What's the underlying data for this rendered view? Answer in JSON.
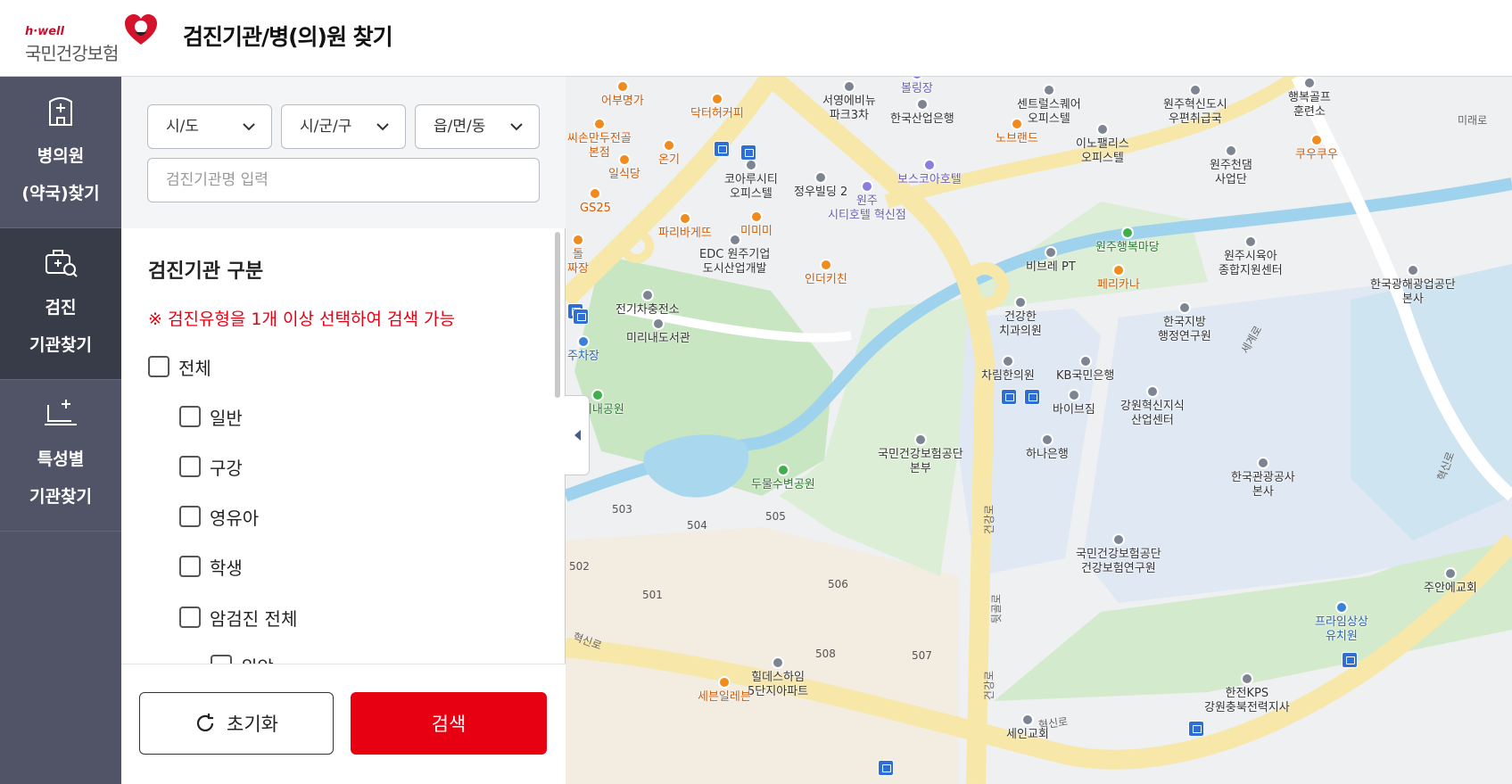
{
  "header": {
    "logo_hwell": "h·well",
    "logo_name": "국민건강보험",
    "title": "검진기관/병(의)원 찾기"
  },
  "sidenav": {
    "items": [
      {
        "label": "병의원\n(약국)찾기",
        "icon": "hospital-building-icon",
        "active": false
      },
      {
        "label": "검진\n기관찾기",
        "icon": "medical-bag-search-icon",
        "active": true
      },
      {
        "label": "특성별\n기관찾기",
        "icon": "laptop-medical-icon",
        "active": false
      }
    ]
  },
  "filters": {
    "sido": "시/도",
    "sigungu": "시/군/구",
    "eupmyeondong": "읍/면/동",
    "search_placeholder": "검진기관명 입력"
  },
  "section": {
    "title": "검진기관 구분",
    "notice": "※ 검진유형을 1개 이상 선택하여 검색 가능"
  },
  "checkboxes": [
    {
      "label": "전체",
      "level": 0,
      "checked": false
    },
    {
      "label": "일반",
      "level": 1,
      "checked": false
    },
    {
      "label": "구강",
      "level": 1,
      "checked": false
    },
    {
      "label": "영유아",
      "level": 1,
      "checked": false
    },
    {
      "label": "학생",
      "level": 1,
      "checked": false
    },
    {
      "label": "암검진 전체",
      "level": 1,
      "checked": false
    },
    {
      "label": "위암",
      "level": 2,
      "checked": false
    }
  ],
  "actions": {
    "reset": "초기화",
    "search": "검색"
  },
  "colors": {
    "accent_red": "#e60012",
    "nav_bg": "#505466",
    "nav_active": "#383b48"
  },
  "map": {
    "pois": [
      {
        "label": "어부명가",
        "kind": "orange"
      },
      {
        "label": "닥터허커피",
        "kind": "orange"
      },
      {
        "label": "씨손만두전골\n본점",
        "kind": "orange"
      },
      {
        "label": "온기",
        "kind": "orange"
      },
      {
        "label": "일식당",
        "kind": "orange"
      },
      {
        "label": "GS25",
        "kind": "orange"
      },
      {
        "label": "돌\n짜장",
        "kind": "orange"
      },
      {
        "label": "서영에비뉴\n파크3차",
        "kind": "gray"
      },
      {
        "label": "한국산업은행",
        "kind": "gray"
      },
      {
        "label": "센트럴스퀘어\n오피스텔",
        "kind": "gray"
      },
      {
        "label": "원주혁신도시\n우편취급국",
        "kind": "gray"
      },
      {
        "label": "행복골프\n훈련소",
        "kind": "gray"
      },
      {
        "label": "노브랜드",
        "kind": "orange"
      },
      {
        "label": "이노팰리스\n오피스텔",
        "kind": "gray"
      },
      {
        "label": "원주천댐\n사업단",
        "kind": "gray"
      },
      {
        "label": "쿠우쿠우",
        "kind": "orange"
      },
      {
        "label": "코아루시티\n오피스텔",
        "kind": "gray"
      },
      {
        "label": "정우빌딩 2",
        "kind": "gray"
      },
      {
        "label": "원주\n시티호텔 혁신점",
        "kind": "purple"
      },
      {
        "label": "보스코아호텔",
        "kind": "purple"
      },
      {
        "label": "미미미",
        "kind": "orange"
      },
      {
        "label": "파리바게뜨",
        "kind": "orange"
      },
      {
        "label": "EDC 원주기업\n도시산업개발",
        "kind": "gray"
      },
      {
        "label": "인더키친",
        "kind": "orange"
      },
      {
        "label": "원주행복마당",
        "kind": "green"
      },
      {
        "label": "비브레 PT",
        "kind": "gray"
      },
      {
        "label": "원주시육아\n종합지원센터",
        "kind": "gray"
      },
      {
        "label": "페리카나",
        "kind": "orange"
      },
      {
        "label": "한국광해광업공단\n본사",
        "kind": "gray"
      },
      {
        "label": "전기차충전소",
        "kind": "gray"
      },
      {
        "label": "미리내도서관",
        "kind": "gray"
      },
      {
        "label": "건강한\n치과의원",
        "kind": "gray"
      },
      {
        "label": "한국지방\n행정연구원",
        "kind": "gray"
      },
      {
        "label": "차림한의원",
        "kind": "gray"
      },
      {
        "label": "KB국민은행",
        "kind": "gray"
      },
      {
        "label": "바이브짐",
        "kind": "gray"
      },
      {
        "label": "강원혁신지식\n산업센터",
        "kind": "gray"
      },
      {
        "label": "미리내공원",
        "kind": "green"
      },
      {
        "label": "국민건강보험공단\n본부",
        "kind": "gray"
      },
      {
        "label": "하나은행",
        "kind": "gray"
      },
      {
        "label": "한국관광공사\n본사",
        "kind": "gray"
      },
      {
        "label": "두물수변공원",
        "kind": "green"
      },
      {
        "label": "국민건강보험공단\n건강보험연구원",
        "kind": "gray"
      },
      {
        "label": "주안에교회",
        "kind": "gray"
      },
      {
        "label": "프라임상상\n유치원",
        "kind": "blue"
      },
      {
        "label": "힐데스하임\n5단지아파트",
        "kind": "gray"
      },
      {
        "label": "세븐일레븐",
        "kind": "orange"
      },
      {
        "label": "한전KPS\n강원충북전력지사",
        "kind": "gray"
      },
      {
        "label": "세인교회",
        "kind": "gray"
      },
      {
        "label": "볼링장",
        "kind": "purple"
      },
      {
        "label": "주차장",
        "kind": "blue"
      }
    ],
    "numbers": [
      "503",
      "504",
      "505",
      "502",
      "501",
      "506",
      "508",
      "507"
    ],
    "roads": [
      "미래로",
      "세계로",
      "혁신로",
      "건강로",
      "혁신로",
      "뒷골로",
      "건강로",
      "혁신로"
    ]
  }
}
